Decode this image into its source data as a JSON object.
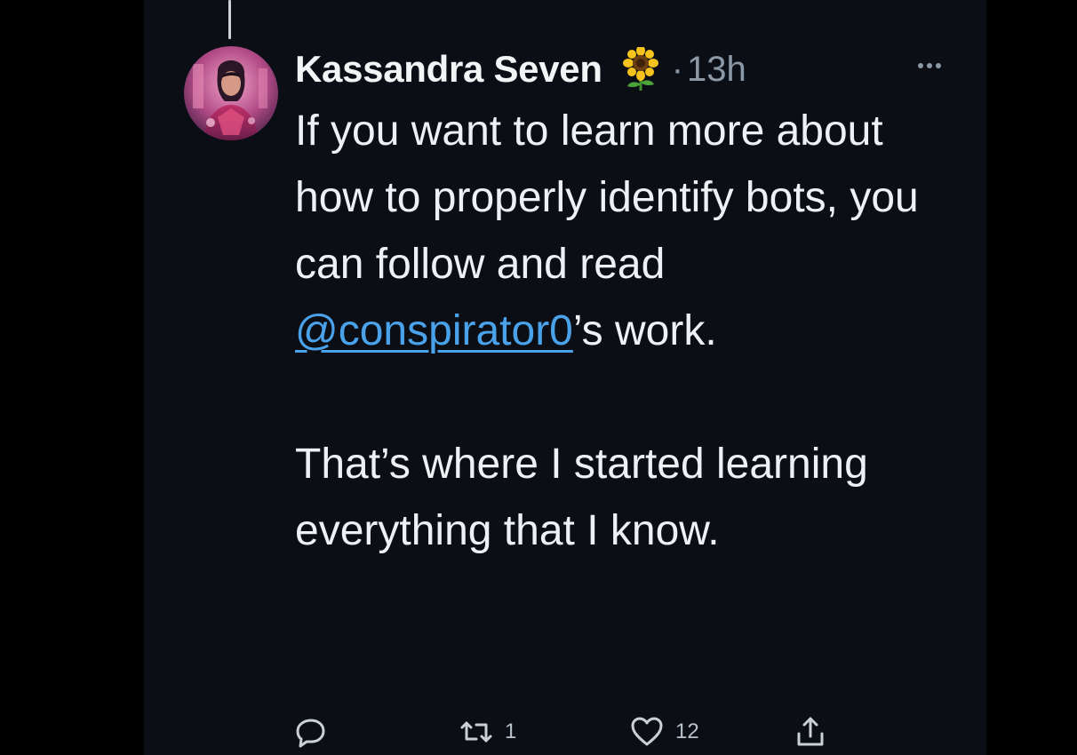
{
  "tweet": {
    "author_name": "Kassandra Seven",
    "badge_icon": "sunflower-emoji",
    "separator": "·",
    "timestamp": "13h",
    "more_icon": "ellipsis-icon",
    "body": {
      "p1_before_mention": "If you want to learn more about how to properly identify bots, you can follow and read ",
      "mention": "@conspirator0",
      "p1_after_mention": "’s work.",
      "p2": "That’s where I started learning everything that I know."
    }
  },
  "actions": {
    "reply_icon": "reply-icon",
    "retweet_icon": "retweet-icon",
    "retweet_count": "1",
    "like_icon": "heart-icon",
    "like_count": "12",
    "share_icon": "share-icon"
  },
  "colors": {
    "background": "#0c0e16",
    "text": "#eef1f4",
    "secondary_text": "#8b98a5",
    "mention": "#4aa3ea"
  }
}
